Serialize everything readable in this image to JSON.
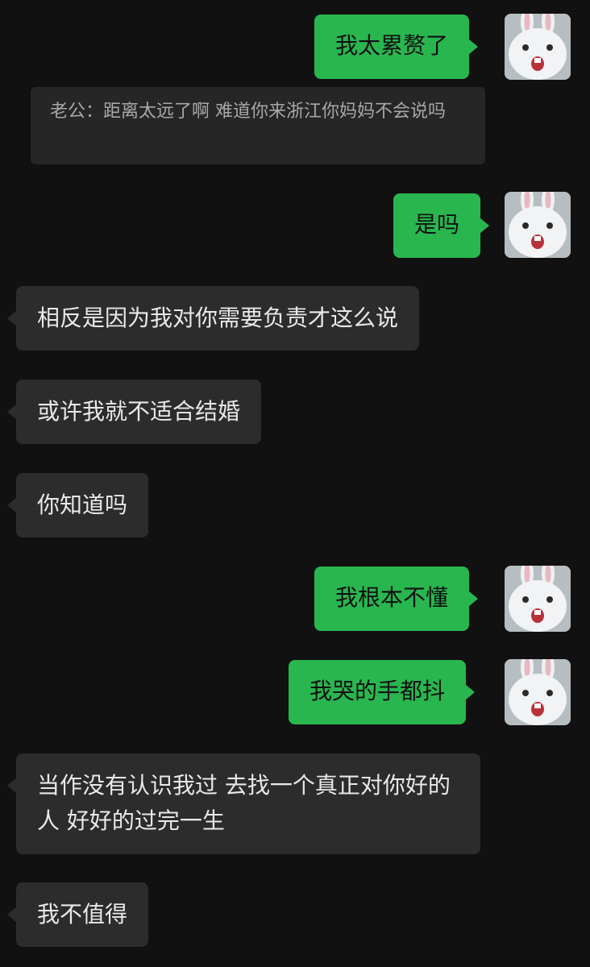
{
  "messages": [
    {
      "id": "m1",
      "side": "out",
      "text": "我太累赘了"
    },
    {
      "id": "q1",
      "side": "quote",
      "text": "老公：距离太远了啊 难道你来浙江你妈妈不会说吗"
    },
    {
      "id": "m2",
      "side": "out",
      "text": "是吗"
    },
    {
      "id": "m3",
      "side": "in",
      "text": "相反是因为我对你需要负责才这么说"
    },
    {
      "id": "m4",
      "side": "in",
      "text": "或许我就不适合结婚"
    },
    {
      "id": "m5",
      "side": "in",
      "text": "你知道吗"
    },
    {
      "id": "m6",
      "side": "out",
      "text": "我根本不懂"
    },
    {
      "id": "m7",
      "side": "out",
      "text": "我哭的手都抖"
    },
    {
      "id": "m8",
      "side": "in",
      "text": "当作没有认识我过 去找一个真正对你好的人 好好的过完一生"
    },
    {
      "id": "m9",
      "side": "in",
      "text": "我不值得"
    }
  ],
  "avatar_icon": "bunny-avatar-icon",
  "colors": {
    "background": "#111111",
    "outgoing_bubble": "#29b64f",
    "incoming_bubble": "#2c2c2c",
    "quote_bg": "#262626"
  }
}
